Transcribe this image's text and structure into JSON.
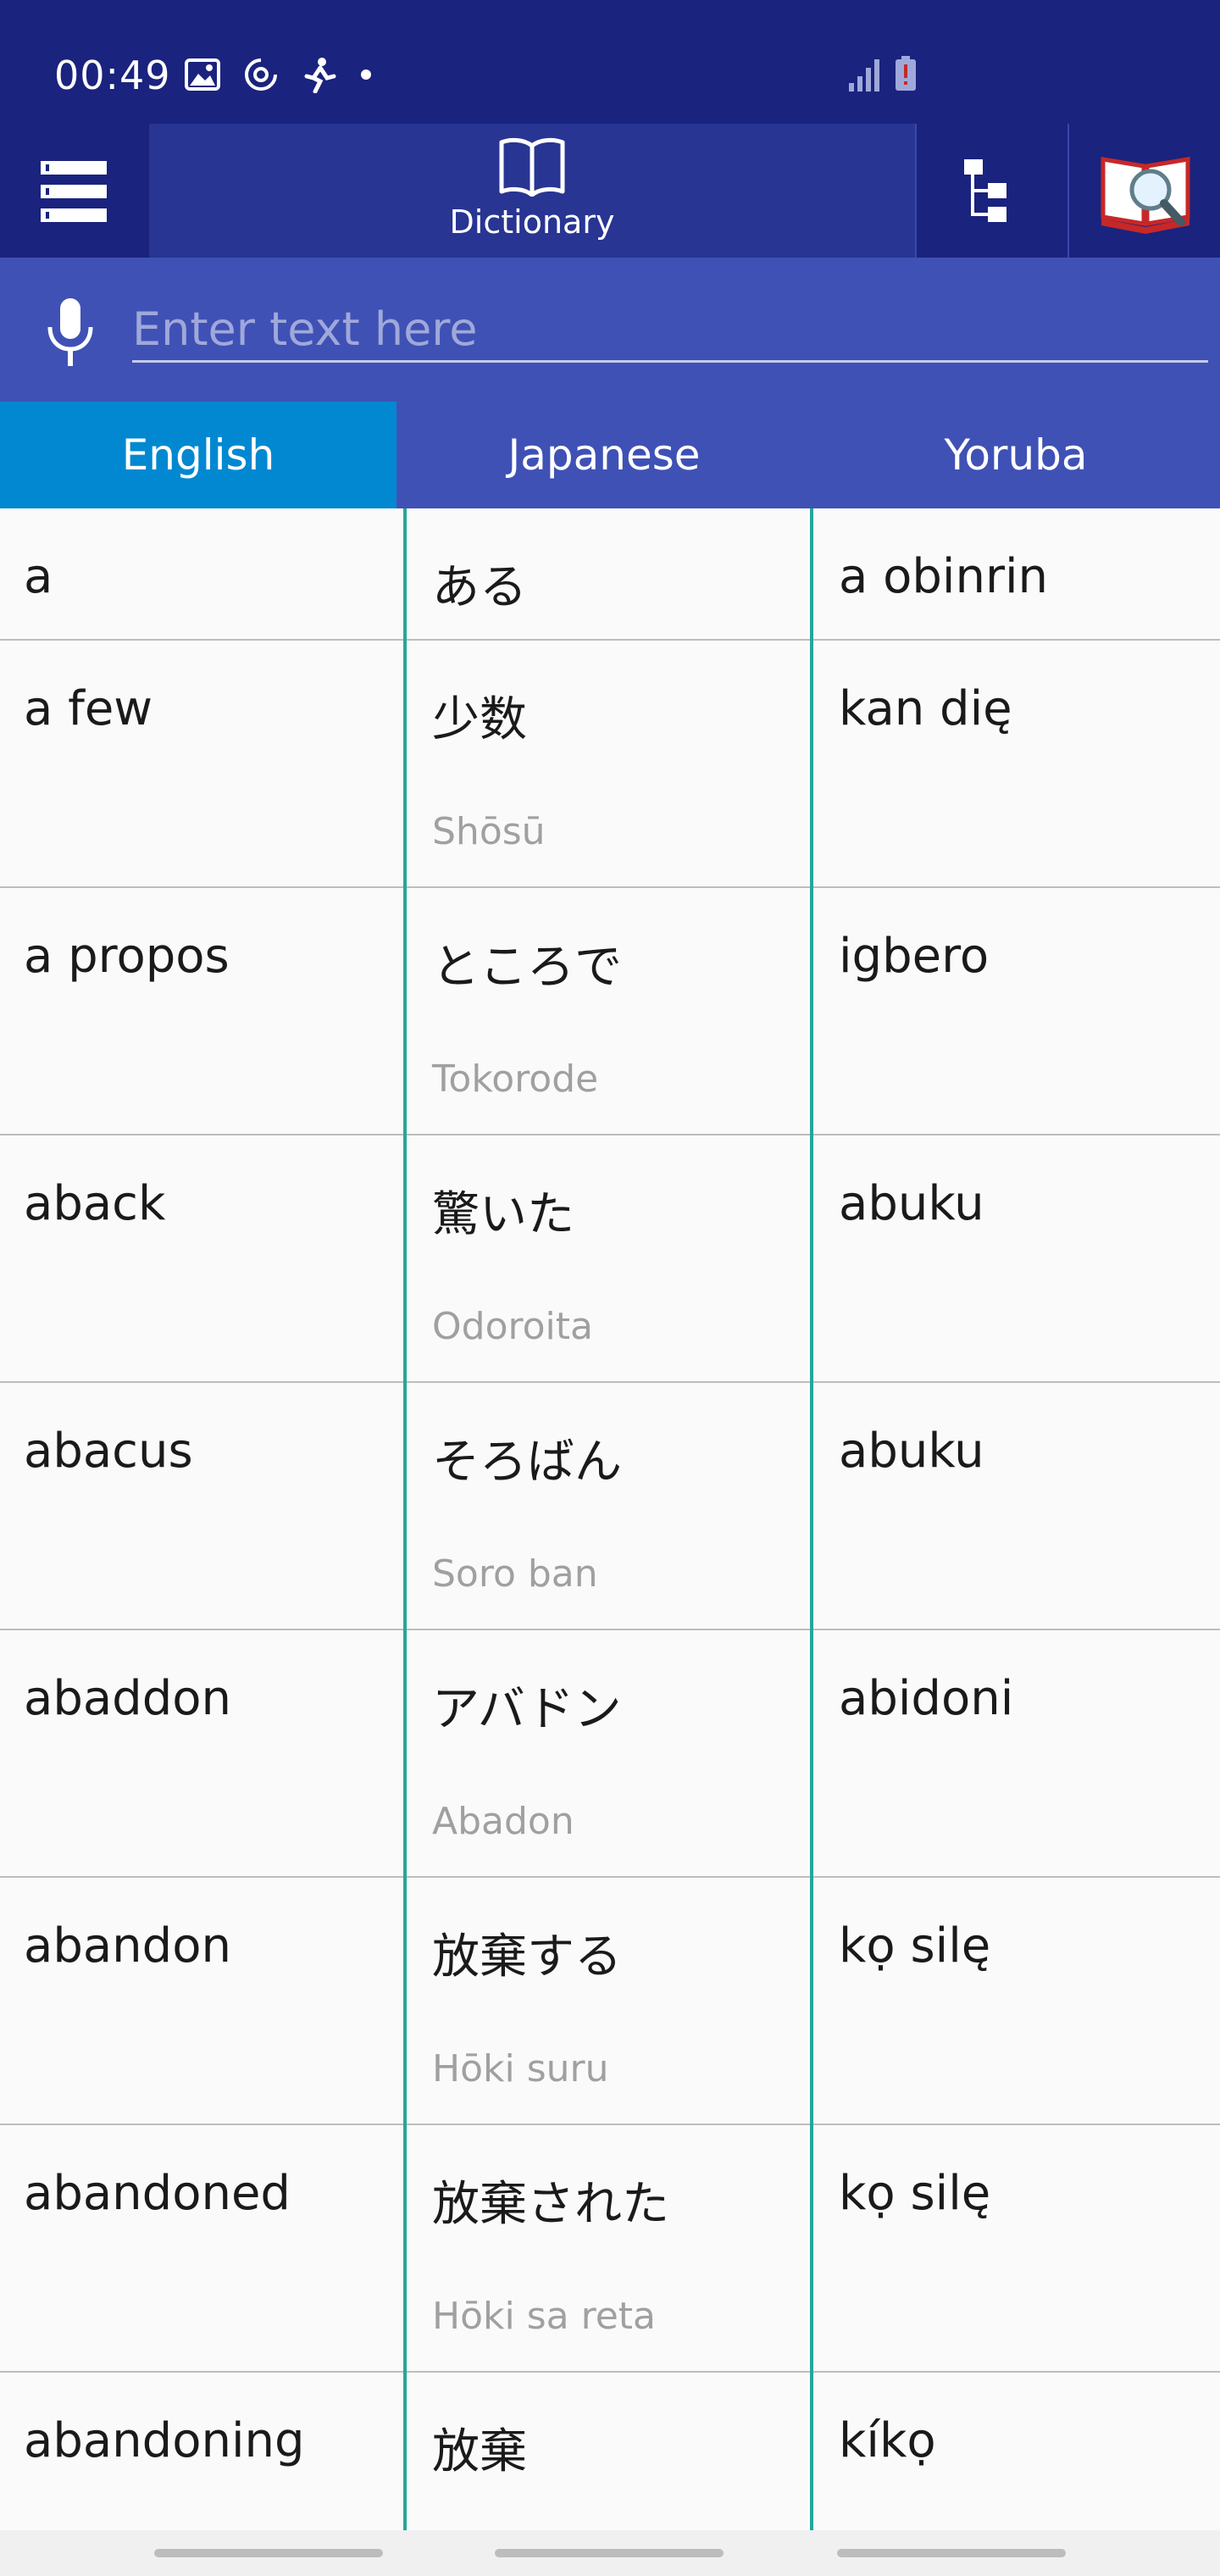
{
  "status_bar": {
    "time": "00:49",
    "icons": [
      "image-icon",
      "sync-icon",
      "activity-icon",
      "dot-icon"
    ],
    "right_icons": [
      "signal-icon",
      "battery-icon"
    ]
  },
  "toolbar": {
    "dictionary_label": "Dictionary",
    "icons": [
      "menu-icon",
      "book-icon",
      "tree-icon",
      "book-search-icon"
    ]
  },
  "search": {
    "placeholder": "Enter text here",
    "value": ""
  },
  "languages": [
    {
      "label": "English",
      "active": true
    },
    {
      "label": "Japanese",
      "active": false
    },
    {
      "label": "Yoruba",
      "active": false
    }
  ],
  "entries": [
    {
      "english": "a",
      "japanese": "ある",
      "romaji": "",
      "yoruba": "a obinrin"
    },
    {
      "english": "a few",
      "japanese": "少数",
      "romaji": "Shōsū",
      "yoruba": "kan dię"
    },
    {
      "english": "a propos",
      "japanese": "ところで",
      "romaji": "Tokorode",
      "yoruba": "igbero"
    },
    {
      "english": "aback",
      "japanese": "驚いた",
      "romaji": "Odoroita",
      "yoruba": "abuku"
    },
    {
      "english": "abacus",
      "japanese": "そろばん",
      "romaji": "Soro ban",
      "yoruba": "abuku"
    },
    {
      "english": "abaddon",
      "japanese": "アバドン",
      "romaji": "Abadon",
      "yoruba": "abidoni"
    },
    {
      "english": "abandon",
      "japanese": "放棄する",
      "romaji": "Hōki suru",
      "yoruba": "kọ silę"
    },
    {
      "english": "abandoned",
      "japanese": "放棄された",
      "romaji": "Hōki sa reta",
      "yoruba": "kọ silę"
    },
    {
      "english": "abandoning",
      "japanese": "放棄",
      "romaji": "",
      "yoruba": "kíkọ"
    }
  ],
  "colors": {
    "status_bar": "#1a237e",
    "toolbar_active": "#283593",
    "search_bar": "#3f51b5",
    "active_tab": "#0288d1",
    "column_divider": "#26a69a"
  }
}
